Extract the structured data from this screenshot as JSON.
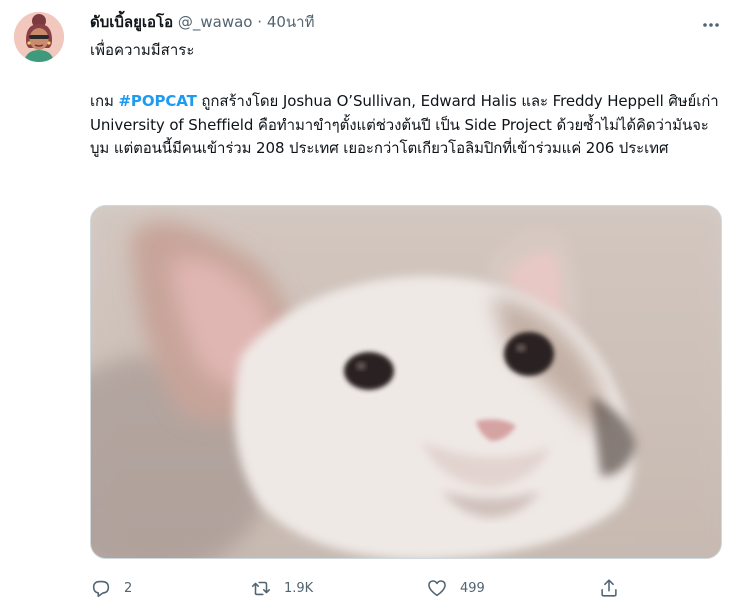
{
  "author": {
    "display_name": "ดับเบิ้ลยูเอโอ",
    "handle": "@_wawao",
    "separator": "·",
    "time": "40นาที"
  },
  "subtitle": "เพื่อความมีสาระ",
  "tweet": {
    "prefix": "เกม ",
    "hashtag": "#POPCAT",
    "text": " ถูกสร้างโดย Joshua O’Sullivan, Edward Halis และ Freddy Heppell ศิษย์เก่า University of Sheffield คือทำมาขำๆตั้งแต่ช่วงต้นปี เป็น Side Project ด้วยซ้ำไม่ได้คิดว่ามันจะบูม แต่ตอนนี้มีคนเข้าร่วม 208 ประเทศ เยอะกว่าโตเกียวโอลิมปิกที่เข้าร่วมแค่ 206 ประเทศ"
  },
  "actions": {
    "reply_count": "2",
    "retweet_count": "1.9K",
    "like_count": "499"
  },
  "colors": {
    "link": "#1d9bf0",
    "secondary_text": "#536471",
    "border": "#cfd9de"
  },
  "icons": [
    "more-icon",
    "reply-icon",
    "retweet-icon",
    "like-icon",
    "share-icon"
  ]
}
